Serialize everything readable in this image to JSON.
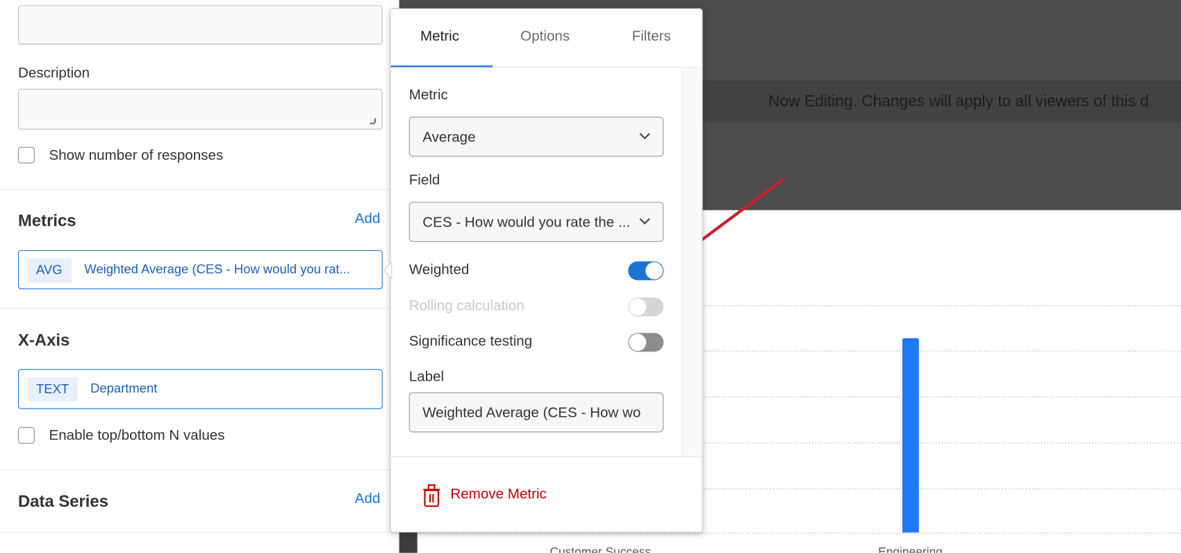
{
  "left_panel": {
    "description_label": "Description",
    "show_responses_label": "Show number of responses",
    "metrics_heading": "Metrics",
    "metrics_add": "Add",
    "metric_tag": "AVG",
    "metric_text": "Weighted Average (CES - How would you rat...",
    "xaxis_heading": "X-Axis",
    "xaxis_tag": "TEXT",
    "xaxis_text": "Department",
    "topn_label": "Enable top/bottom N values",
    "data_series_heading": "Data Series",
    "data_series_add": "Add"
  },
  "banner": "Now Editing. Changes will apply to all viewers of this d",
  "chart": {
    "categories": [
      "Customer Success",
      "Engineering"
    ]
  },
  "popover": {
    "tabs": [
      "Metric",
      "Options",
      "Filters"
    ],
    "metric_label": "Metric",
    "metric_value": "Average",
    "field_label": "Field",
    "field_value": "CES - How would you rate the ...",
    "weighted_label": "Weighted",
    "weighted_on": true,
    "rolling_label": "Rolling calculation",
    "rolling_on": false,
    "significance_label": "Significance testing",
    "significance_on": false,
    "label_label": "Label",
    "label_value": "Weighted Average (CES - How wo",
    "remove_label": "Remove Metric"
  },
  "colors": {
    "accent": "#1a73d6",
    "bar": "#2178f5",
    "danger": "#c00000",
    "arrow": "#c8202f"
  }
}
